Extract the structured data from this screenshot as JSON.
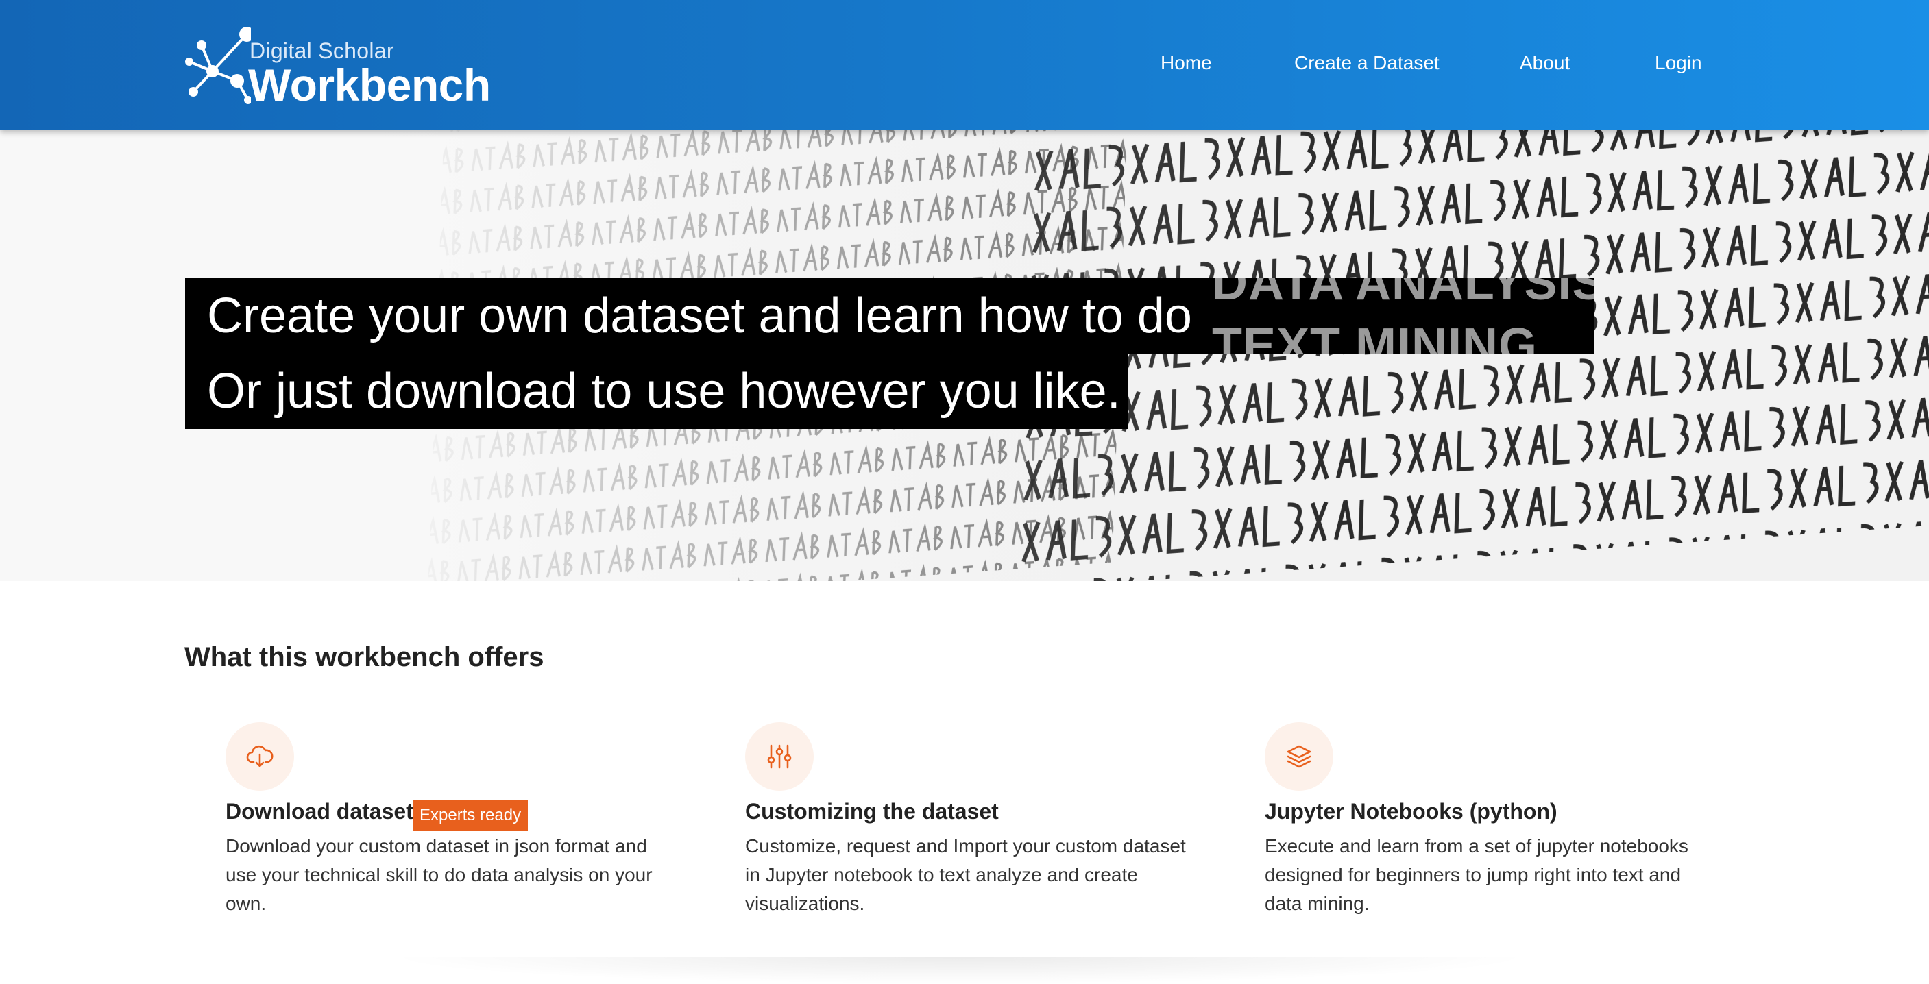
{
  "header": {
    "logo_small": "Digital Scholar",
    "logo_big": "Workbench",
    "nav": [
      {
        "label": "Home"
      },
      {
        "label": "Create a Dataset"
      },
      {
        "label": "About"
      },
      {
        "label": "Login"
      }
    ]
  },
  "hero": {
    "line1": "Create your own dataset and learn how to do",
    "line2": "Or just download to use however you like.",
    "ticker": [
      "DATA ANALYSIS",
      "TEXT MINING"
    ]
  },
  "offers": {
    "title": "What this workbench offers",
    "items": [
      {
        "icon": "cloud-download-icon",
        "title": "Download dataset",
        "badge": "Experts ready",
        "desc": "Download your custom dataset in json format and use your technical skill to do data analysis on your own."
      },
      {
        "icon": "sliders-icon",
        "title": "Customizing the dataset",
        "desc": "Customize, request and Import your custom dataset in Jupyter notebook to text analyze and create visualizations."
      },
      {
        "icon": "layers-icon",
        "title": "Jupyter Notebooks (python)",
        "desc": "Execute and learn from a set of jupyter notebooks designed for beginners to jump right into text and data mining."
      }
    ]
  },
  "colors": {
    "header_start": "#1366b6",
    "header_end": "#1a8fe6",
    "accent": "#e8601d",
    "icon_bg": "#fdf1ea"
  }
}
